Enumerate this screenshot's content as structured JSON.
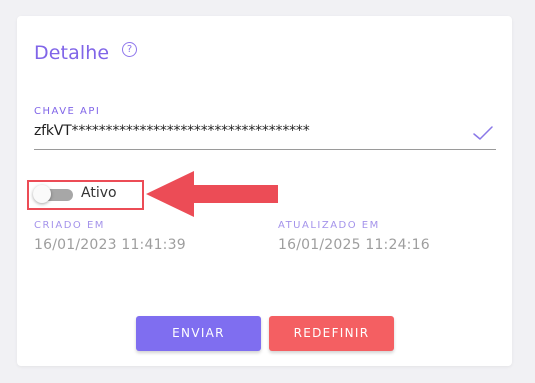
{
  "card": {
    "title": "Detalhe",
    "help_icon": "?"
  },
  "api_key": {
    "label": "CHAVE API",
    "value": "zfkVT***********************************"
  },
  "status_toggle": {
    "label": "Ativo",
    "checked": false
  },
  "created": {
    "label": "CRIADO EM",
    "value": "16/01/2023 11:41:39"
  },
  "updated": {
    "label": "ATUALIZADO EM",
    "value": "16/01/2025 11:24:16"
  },
  "buttons": {
    "send": "ENVIAR",
    "reset": "REDEFINIR"
  },
  "colors": {
    "accent": "#8065e8",
    "primary_button": "#7f6ef0",
    "danger_button": "#f45f62",
    "highlight": "#ec4c56"
  }
}
